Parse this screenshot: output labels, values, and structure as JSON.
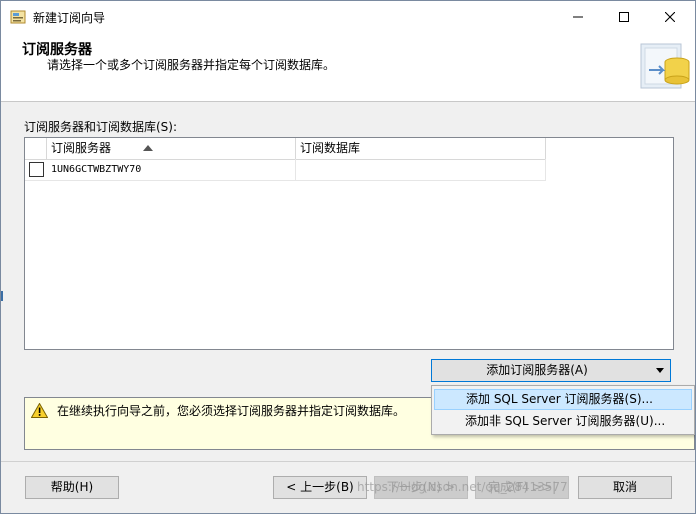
{
  "window": {
    "title": "新建订阅向导",
    "controls": {
      "minimize": "—",
      "maximize": "☐",
      "close": "✕"
    }
  },
  "header": {
    "title": "订阅服务器",
    "subtitle": "请选择一个或多个订阅服务器并指定每个订阅数据库。"
  },
  "grid": {
    "label": "订阅服务器和订阅数据库(S):",
    "columns": [
      "订阅服务器",
      "订阅数据库"
    ],
    "sort_icon": "sort-ascending-icon",
    "rows": [
      {
        "checked": false,
        "subscriber": "1UN6GCTWBZTWY70",
        "database": ""
      }
    ]
  },
  "add_dropdown": {
    "label": "添加订阅服务器(A)",
    "menu": [
      {
        "label": "添加 SQL Server 订阅服务器(S)...",
        "highlighted": true
      },
      {
        "label": "添加非 SQL Server 订阅服务器(U)...",
        "highlighted": false
      }
    ]
  },
  "message": {
    "icon": "warning-icon",
    "text": "在继续执行向导之前，您必须选择订阅服务器并指定订阅数据库。"
  },
  "buttons": {
    "help": "帮助(H)",
    "back": "< 上一步(B)",
    "next": "下一步(N) >",
    "finish": "完成(F) >>|",
    "cancel": "取消"
  },
  "watermark": "https://blog.csdn.net/qq_28413577",
  "colors": {
    "accent": "#0078d7",
    "menu_highlight": "#cce8ff",
    "message_bg": "#ffffe1"
  }
}
